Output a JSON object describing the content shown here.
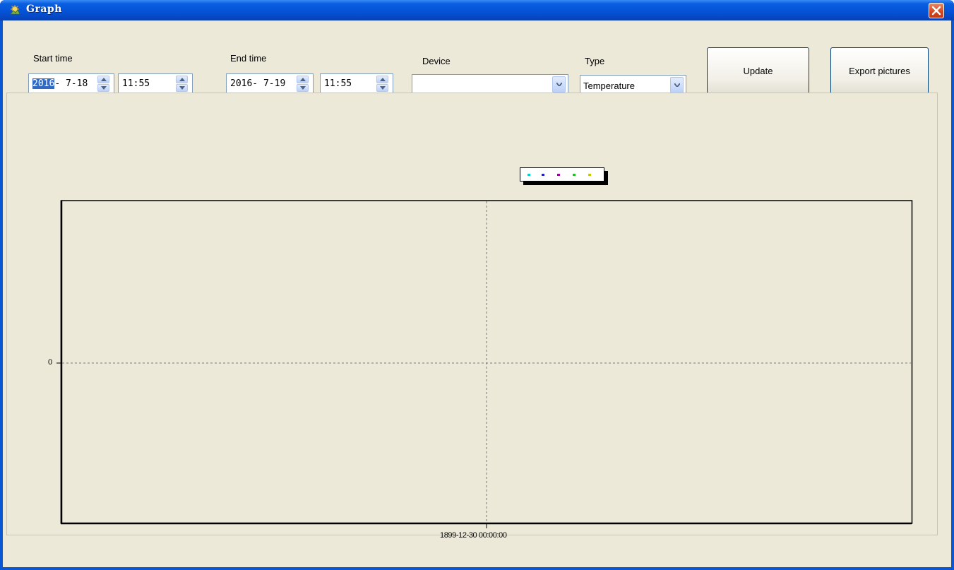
{
  "window": {
    "title": "Graph",
    "close_icon": "close-icon"
  },
  "toolbar": {
    "start_time": {
      "label": "Start time",
      "date_year": "2016",
      "date_rest": "- 7-18",
      "time": "11:55"
    },
    "end_time": {
      "label": "End time",
      "date": "2016- 7-19",
      "time": "11:55"
    },
    "device": {
      "label": "Device",
      "value": ""
    },
    "type": {
      "label": "Type",
      "value": "Temperature"
    },
    "update_label": "Update",
    "export_label": "Export pictures"
  },
  "legend": {
    "colors": [
      "#00d0d0",
      "#2020c0",
      "#a000a0",
      "#20c020",
      "#c8c800"
    ]
  },
  "chart_data": {
    "type": "line",
    "x_tick_labels": [
      "1899-12-30 00:00:00"
    ],
    "y_tick_labels": [
      "0"
    ],
    "series": [],
    "grid": true
  },
  "colors": {
    "titlebar": "#0553d8",
    "client": "#ece9d8",
    "selection": "#316ac5",
    "field_border": "#7f9db9"
  }
}
